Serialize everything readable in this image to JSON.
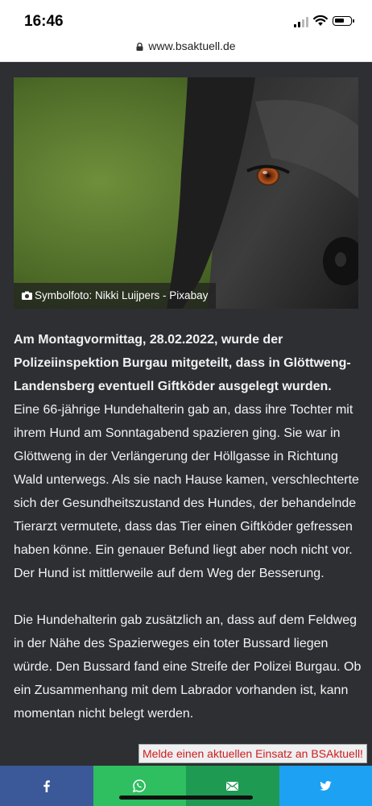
{
  "status": {
    "time": "16:46"
  },
  "browser": {
    "url": "www.bsaktuell.de"
  },
  "article": {
    "image_caption": "Symbolfoto: Nikki Luijpers - Pixabay",
    "lead": "Am Montagvormittag, 28.02.2022, wurde der Polizeiinspektion Burgau mitgeteilt, dass in Glöttweng-Landensberg eventuell Giftköder ausgelegt wurden.",
    "paragraph1": "Eine 66-jährige Hundehalterin gab an, dass ihre Tochter mit ihrem Hund am Sonntagabend spazieren ging. Sie war in Glöttweng in der Verlängerung der Höllgasse in Richtung Wald unterwegs. Als sie nach Hause kamen, verschlechterte sich der Gesundheitszustand des Hundes, der behandelnde Tierarzt vermutete, dass das Tier einen Giftköder gefressen haben könne. Ein genauer Befund liegt aber noch nicht vor. Der Hund ist mittlerweile auf dem Weg der Besserung.",
    "paragraph2": "Die Hundehalterin gab zusätzlich an, dass auf dem Feldweg in der Nähe des Spazierweges ein toter Bussard liegen würde. Den Bussard fand eine Streife der Polizei Burgau. Ob ein Zusammenhang mit dem Labrador vorhanden ist, kann momentan nicht belegt werden."
  },
  "report_banner": "Melde einen aktuellen Einsatz an BSAktuell!",
  "share": [
    {
      "icon": "facebook-icon",
      "color": "#3b5998"
    },
    {
      "icon": "whatsapp-icon",
      "color": "#2fbe60"
    },
    {
      "icon": "email-icon",
      "color": "#1f9a52"
    },
    {
      "icon": "twitter-icon",
      "color": "#1da1f2"
    }
  ]
}
